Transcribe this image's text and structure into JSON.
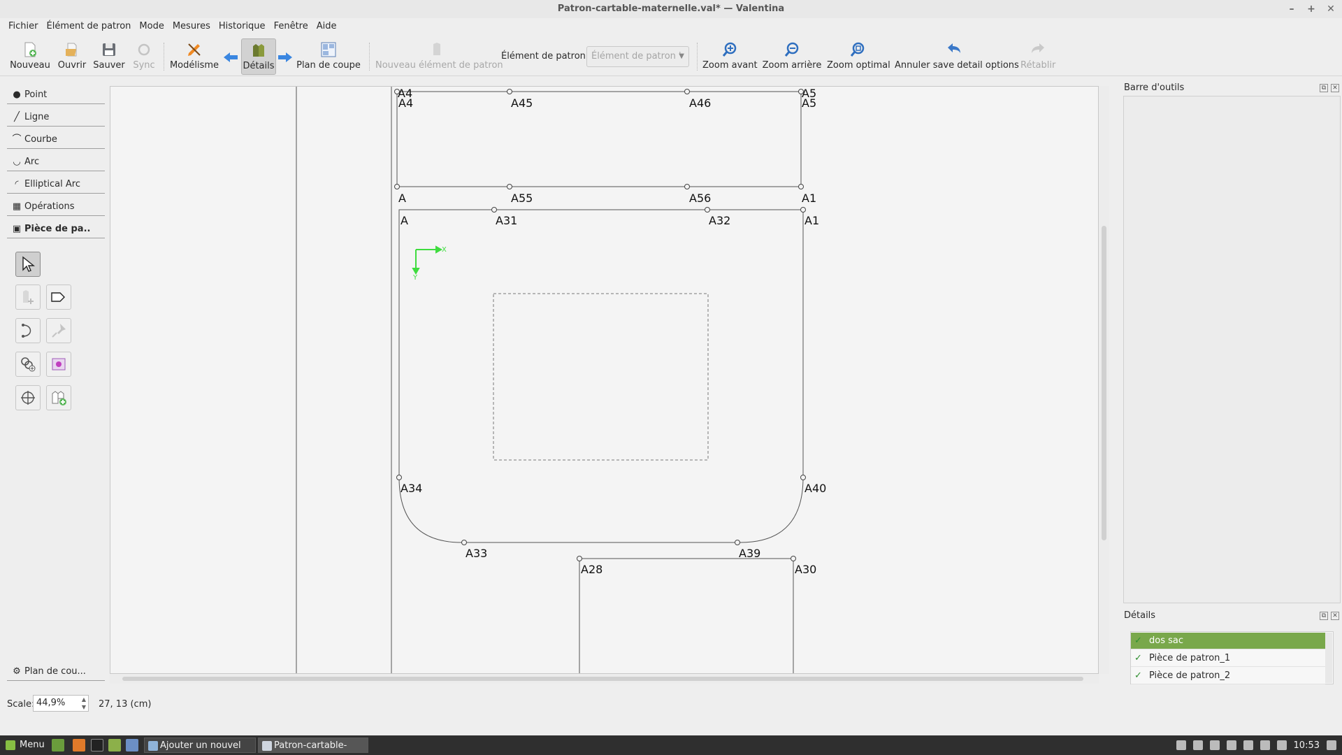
{
  "window": {
    "title": "Patron-cartable-maternelle.val* — Valentina",
    "controls": [
      "–",
      "+",
      "✕"
    ]
  },
  "menu": [
    "Fichier",
    "Élément de patron",
    "Mode",
    "Mesures",
    "Historique",
    "Fenêtre",
    "Aide"
  ],
  "toolbar": {
    "new": "Nouveau",
    "open": "Ouvrir",
    "save": "Sauver",
    "sync": "Sync",
    "modelisme": "Modélisme",
    "details": "Détails",
    "layout": "Plan de coupe",
    "new_piece": "Nouveau élément de patron",
    "piece_label": "Élément de patron :",
    "piece_value": "Élément de patron '",
    "zoom_in": "Zoom avant",
    "zoom_out": "Zoom arrière",
    "zoom_fit": "Zoom optimal",
    "undo": "Annuler save detail options",
    "redo": "Rétablir"
  },
  "tools": {
    "tabs": [
      "Point",
      "Ligne",
      "Courbe",
      "Arc",
      "Elliptical Arc",
      "Opérations",
      "Pièce de pa.."
    ],
    "bottom_tab": "Plan de cou..."
  },
  "canvas": {
    "points": [
      "A4",
      "A45",
      "A46",
      "A5",
      "A",
      "A55",
      "A56",
      "A1",
      "A",
      "A31",
      "A32",
      "A1",
      "A34",
      "A40",
      "A33",
      "A39",
      "A28",
      "A30",
      "A4",
      "A5"
    ],
    "axis_x": "X",
    "axis_y": "Y"
  },
  "right": {
    "toolbox_title": "Barre d'outils",
    "details_title": "Détails",
    "details": [
      {
        "label": "dos sac",
        "selected": true
      },
      {
        "label": "Pièce de patron_1",
        "selected": false
      },
      {
        "label": "Pièce de patron_2",
        "selected": false
      }
    ]
  },
  "status": {
    "scale_label": "Scale:",
    "scale_value": "44,9%",
    "coords": "27, 13 (cm)"
  },
  "taskbar": {
    "menu": "Menu",
    "windows": [
      "Ajouter un nouvel ar...",
      "Patron-cartable-mat..."
    ],
    "clock": "10:53"
  },
  "colors": {
    "selected_row": "#79a84b",
    "axis": "#3fdc3f",
    "zoom_icon": "#2f6fbf",
    "arrow_blue": "#3a86e0"
  }
}
